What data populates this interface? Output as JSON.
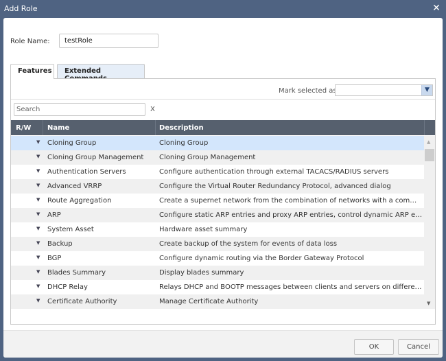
{
  "window": {
    "title": "Add Role",
    "close_icon": "close-icon"
  },
  "form": {
    "role_name_label": "Role Name:",
    "role_name_value": "testRole"
  },
  "tabs": [
    {
      "label": "Features",
      "active": true
    },
    {
      "label": "Extended Commands",
      "active": false
    }
  ],
  "toolbar": {
    "mark_selected_label": "Mark selected as:",
    "mark_selected_value": "",
    "dropdown_icon": "chevron-down-icon"
  },
  "search": {
    "placeholder": "Search",
    "value": "",
    "clear_label": "X"
  },
  "grid": {
    "columns": [
      "R/W",
      "Name",
      "Description"
    ],
    "rows": [
      {
        "rw": "▼",
        "name": "Cloning Group",
        "description": "Cloning Group",
        "selected": true
      },
      {
        "rw": "▼",
        "name": "Cloning Group Management",
        "description": "Cloning Group Management"
      },
      {
        "rw": "▼",
        "name": "Authentication Servers",
        "description": "Configure authentication through external TACACS/RADIUS servers"
      },
      {
        "rw": "▼",
        "name": "Advanced VRRP",
        "description": "Configure the Virtual Router Redundancy Protocol, advanced dialog"
      },
      {
        "rw": "▼",
        "name": "Route Aggregation",
        "description": "Create a supernet network from the combination of networks with a common ro..."
      },
      {
        "rw": "▼",
        "name": "ARP",
        "description": "Configure static ARP entries and proxy ARP entries, control dynamic ARP entries"
      },
      {
        "rw": "▼",
        "name": "System Asset",
        "description": "Hardware asset summary"
      },
      {
        "rw": "▼",
        "name": "Backup",
        "description": "Create backup of the system for events of data loss"
      },
      {
        "rw": "▼",
        "name": "BGP",
        "description": "Configure dynamic routing via the Border Gateway Protocol"
      },
      {
        "rw": "▼",
        "name": "Blades Summary",
        "description": "Display blades summary"
      },
      {
        "rw": "▼",
        "name": "DHCP Relay",
        "description": "Relays DHCP and BOOTP messages between clients and servers on different IP ..."
      },
      {
        "rw": "▼",
        "name": "Certificate Authority",
        "description": "Manage Certificate Authority"
      }
    ]
  },
  "buttons": {
    "ok": "OK",
    "cancel": "Cancel"
  },
  "colors": {
    "titlebar": "#4f6382",
    "grid_header": "#56606e",
    "selected_row": "#d3e6fc",
    "active_tab": "#ffffff",
    "inactive_tab": "#e6eef8"
  }
}
